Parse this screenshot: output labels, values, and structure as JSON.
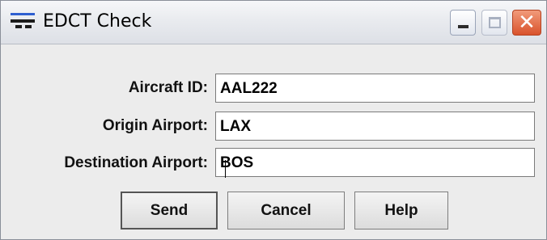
{
  "window": {
    "title": "EDCT Check",
    "close_glyph": "✕"
  },
  "form": {
    "aircraft_id_label": "Aircraft ID:",
    "aircraft_id_value": "AAL222",
    "origin_label": "Origin Airport:",
    "origin_value": "LAX",
    "destination_label": "Destination Airport:",
    "destination_value": "BOS"
  },
  "buttons": {
    "send": "Send",
    "cancel": "Cancel",
    "help": "Help"
  },
  "icons": {
    "app": "app-menu-icon",
    "minimize": "minimize-icon",
    "maximize": "maximize-icon",
    "close": "close-icon"
  },
  "colors": {
    "close_button": "#d9532c",
    "dialog_bg": "#ececec"
  }
}
